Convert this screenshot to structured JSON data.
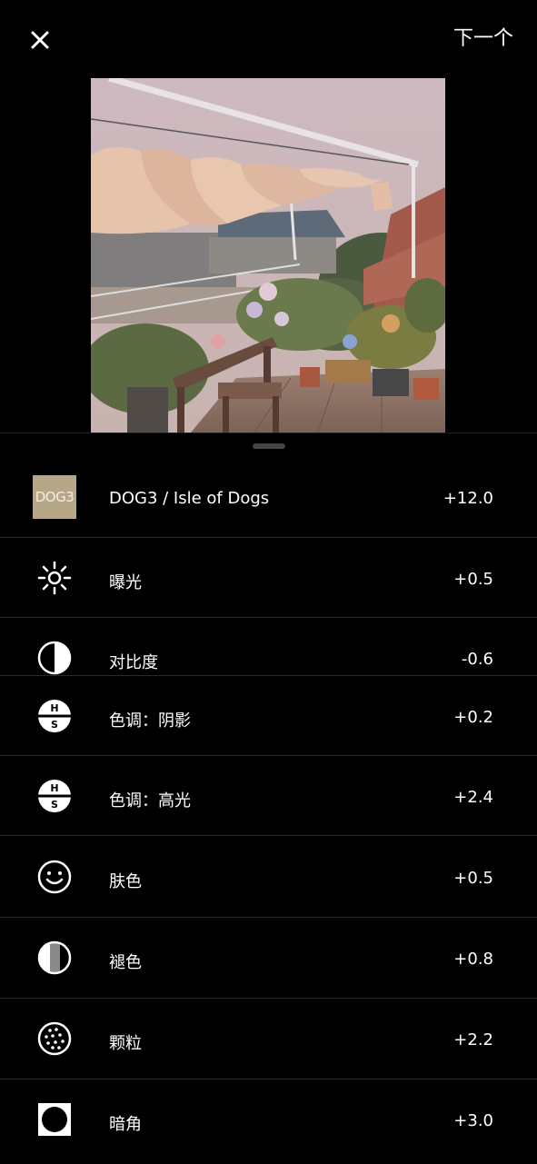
{
  "topbar": {
    "close_icon": "close-icon",
    "next_label": "下一个"
  },
  "photo": {
    "description_icon": "rooftop-garden-photo"
  },
  "adjustments": [
    {
      "id": "preset",
      "icon": "preset-thumbnail",
      "thumb_text": "DOG3",
      "label": "DOG3 / Isle of Dogs",
      "value": "+12.0"
    },
    {
      "id": "exposure",
      "icon": "sun-icon",
      "label": "曝光",
      "value": "+0.5"
    },
    {
      "id": "contrast",
      "icon": "contrast-icon",
      "label": "对比度",
      "value": "-0.6"
    },
    {
      "id": "tint-shadows",
      "icon": "hs-icon",
      "label": "色调：阴影",
      "value": "+0.2"
    },
    {
      "id": "tint-highlights",
      "icon": "hs-icon",
      "label": "色调：高光",
      "value": "+2.4"
    },
    {
      "id": "skin-tone",
      "icon": "smiley-icon",
      "label": "肤色",
      "value": "+0.5"
    },
    {
      "id": "fade",
      "icon": "fade-icon",
      "label": "褪色",
      "value": "+0.8"
    },
    {
      "id": "grain",
      "icon": "grain-icon",
      "label": "颗粒",
      "value": "+2.2"
    },
    {
      "id": "vignette",
      "icon": "vignette-icon",
      "label": "暗角",
      "value": "+3.0"
    }
  ]
}
